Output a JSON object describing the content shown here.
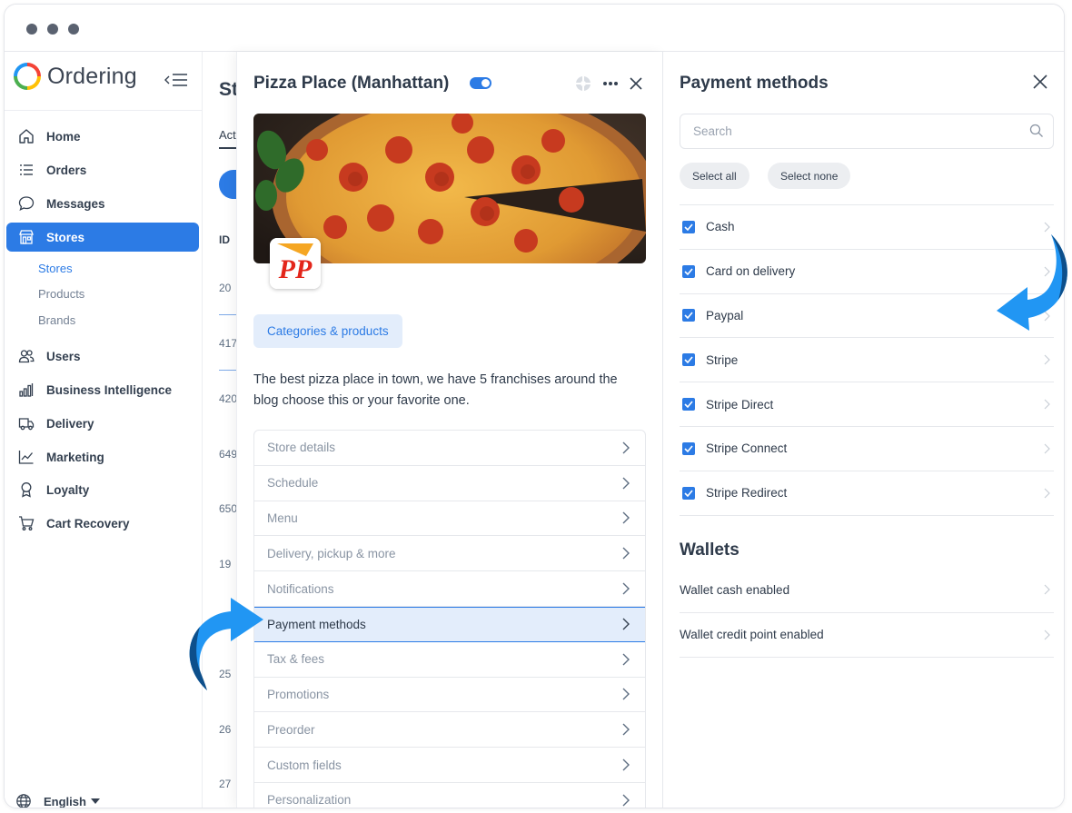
{
  "app": {
    "brand": "Ordering"
  },
  "sidebar": {
    "items": [
      {
        "label": "Home",
        "icon": "home-icon"
      },
      {
        "label": "Orders",
        "icon": "list-icon"
      },
      {
        "label": "Messages",
        "icon": "chat-bubble-icon"
      },
      {
        "label": "Stores",
        "icon": "storefront-icon",
        "active": true
      },
      {
        "label": "Users",
        "icon": "users-icon"
      },
      {
        "label": "Business Intelligence",
        "icon": "bar-chart-icon"
      },
      {
        "label": "Delivery",
        "icon": "truck-icon"
      },
      {
        "label": "Marketing",
        "icon": "line-chart-icon"
      },
      {
        "label": "Loyalty",
        "icon": "award-icon"
      },
      {
        "label": "Cart Recovery",
        "icon": "cart-icon"
      }
    ],
    "subitems": [
      {
        "label": "Stores",
        "active": true
      },
      {
        "label": "Products"
      },
      {
        "label": "Brands"
      }
    ],
    "language": "English"
  },
  "background_list": {
    "title": "St",
    "tab": "Act",
    "id_header": "ID",
    "ids": [
      "20",
      "417",
      "420",
      "649",
      "650",
      "19",
      "25",
      "26",
      "27"
    ]
  },
  "store": {
    "title": "Pizza Place (Manhattan)",
    "enabled": true,
    "logo_text": "PP",
    "categories_button": "Categories & products",
    "description": "The best pizza place in town, we have 5 franchises around the blog choose this or your favorite one.",
    "menu": [
      {
        "label": "Store details"
      },
      {
        "label": "Schedule"
      },
      {
        "label": "Menu"
      },
      {
        "label": "Delivery, pickup & more"
      },
      {
        "label": "Notifications"
      },
      {
        "label": "Payment methods",
        "active": true
      },
      {
        "label": "Tax & fees"
      },
      {
        "label": "Promotions"
      },
      {
        "label": "Preorder"
      },
      {
        "label": "Custom fields"
      },
      {
        "label": "Personalization"
      }
    ]
  },
  "payment": {
    "title": "Payment methods",
    "search_placeholder": "Search",
    "select_all": "Select all",
    "select_none": "Select none",
    "methods": [
      {
        "label": "Cash",
        "checked": true
      },
      {
        "label": "Card on delivery",
        "checked": true
      },
      {
        "label": "Paypal",
        "checked": true
      },
      {
        "label": "Stripe",
        "checked": true
      },
      {
        "label": "Stripe Direct",
        "checked": true
      },
      {
        "label": "Stripe Connect",
        "checked": true
      },
      {
        "label": "Stripe Redirect",
        "checked": true
      }
    ],
    "wallets_title": "Wallets",
    "wallets": [
      {
        "label": "Wallet cash enabled"
      },
      {
        "label": "Wallet credit point enabled"
      }
    ]
  },
  "colors": {
    "accent": "#2c7be5",
    "active_row_bg": "#e3edfb",
    "arrow_blue": "#2196f3",
    "arrow_dark": "#0d4f8b"
  }
}
